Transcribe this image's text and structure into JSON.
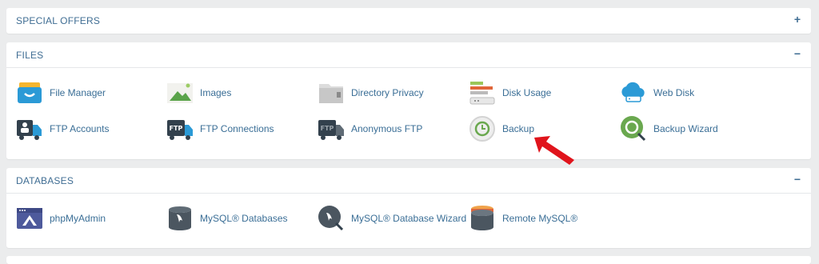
{
  "sections": {
    "special_offers": {
      "title": "SPECIAL OFFERS",
      "toggle": "+"
    },
    "files": {
      "title": "FILES",
      "toggle": "−",
      "items": [
        {
          "label": "File Manager",
          "icon": "file-manager-icon"
        },
        {
          "label": "Images",
          "icon": "images-icon"
        },
        {
          "label": "Directory Privacy",
          "icon": "directory-privacy-icon"
        },
        {
          "label": "Disk Usage",
          "icon": "disk-usage-icon"
        },
        {
          "label": "Web Disk",
          "icon": "web-disk-icon"
        },
        {
          "label": "FTP Accounts",
          "icon": "ftp-accounts-icon"
        },
        {
          "label": "FTP Connections",
          "icon": "ftp-connections-icon"
        },
        {
          "label": "Anonymous FTP",
          "icon": "anonymous-ftp-icon"
        },
        {
          "label": "Backup",
          "icon": "backup-icon"
        },
        {
          "label": "Backup Wizard",
          "icon": "backup-wizard-icon"
        }
      ]
    },
    "databases": {
      "title": "DATABASES",
      "toggle": "−",
      "items": [
        {
          "label": "phpMyAdmin",
          "icon": "phpmyadmin-icon"
        },
        {
          "label": "MySQL® Databases",
          "icon": "mysql-databases-icon"
        },
        {
          "label": "MySQL® Database Wizard",
          "icon": "mysql-database-wizard-icon"
        },
        {
          "label": "Remote MySQL®",
          "icon": "remote-mysql-icon"
        }
      ]
    }
  },
  "icon_text": {
    "ftp": "FTP"
  },
  "colors": {
    "accent": "#3f6d93",
    "label": "#3a6e96",
    "arrow": "#e0141c",
    "background": "#ebeced"
  }
}
